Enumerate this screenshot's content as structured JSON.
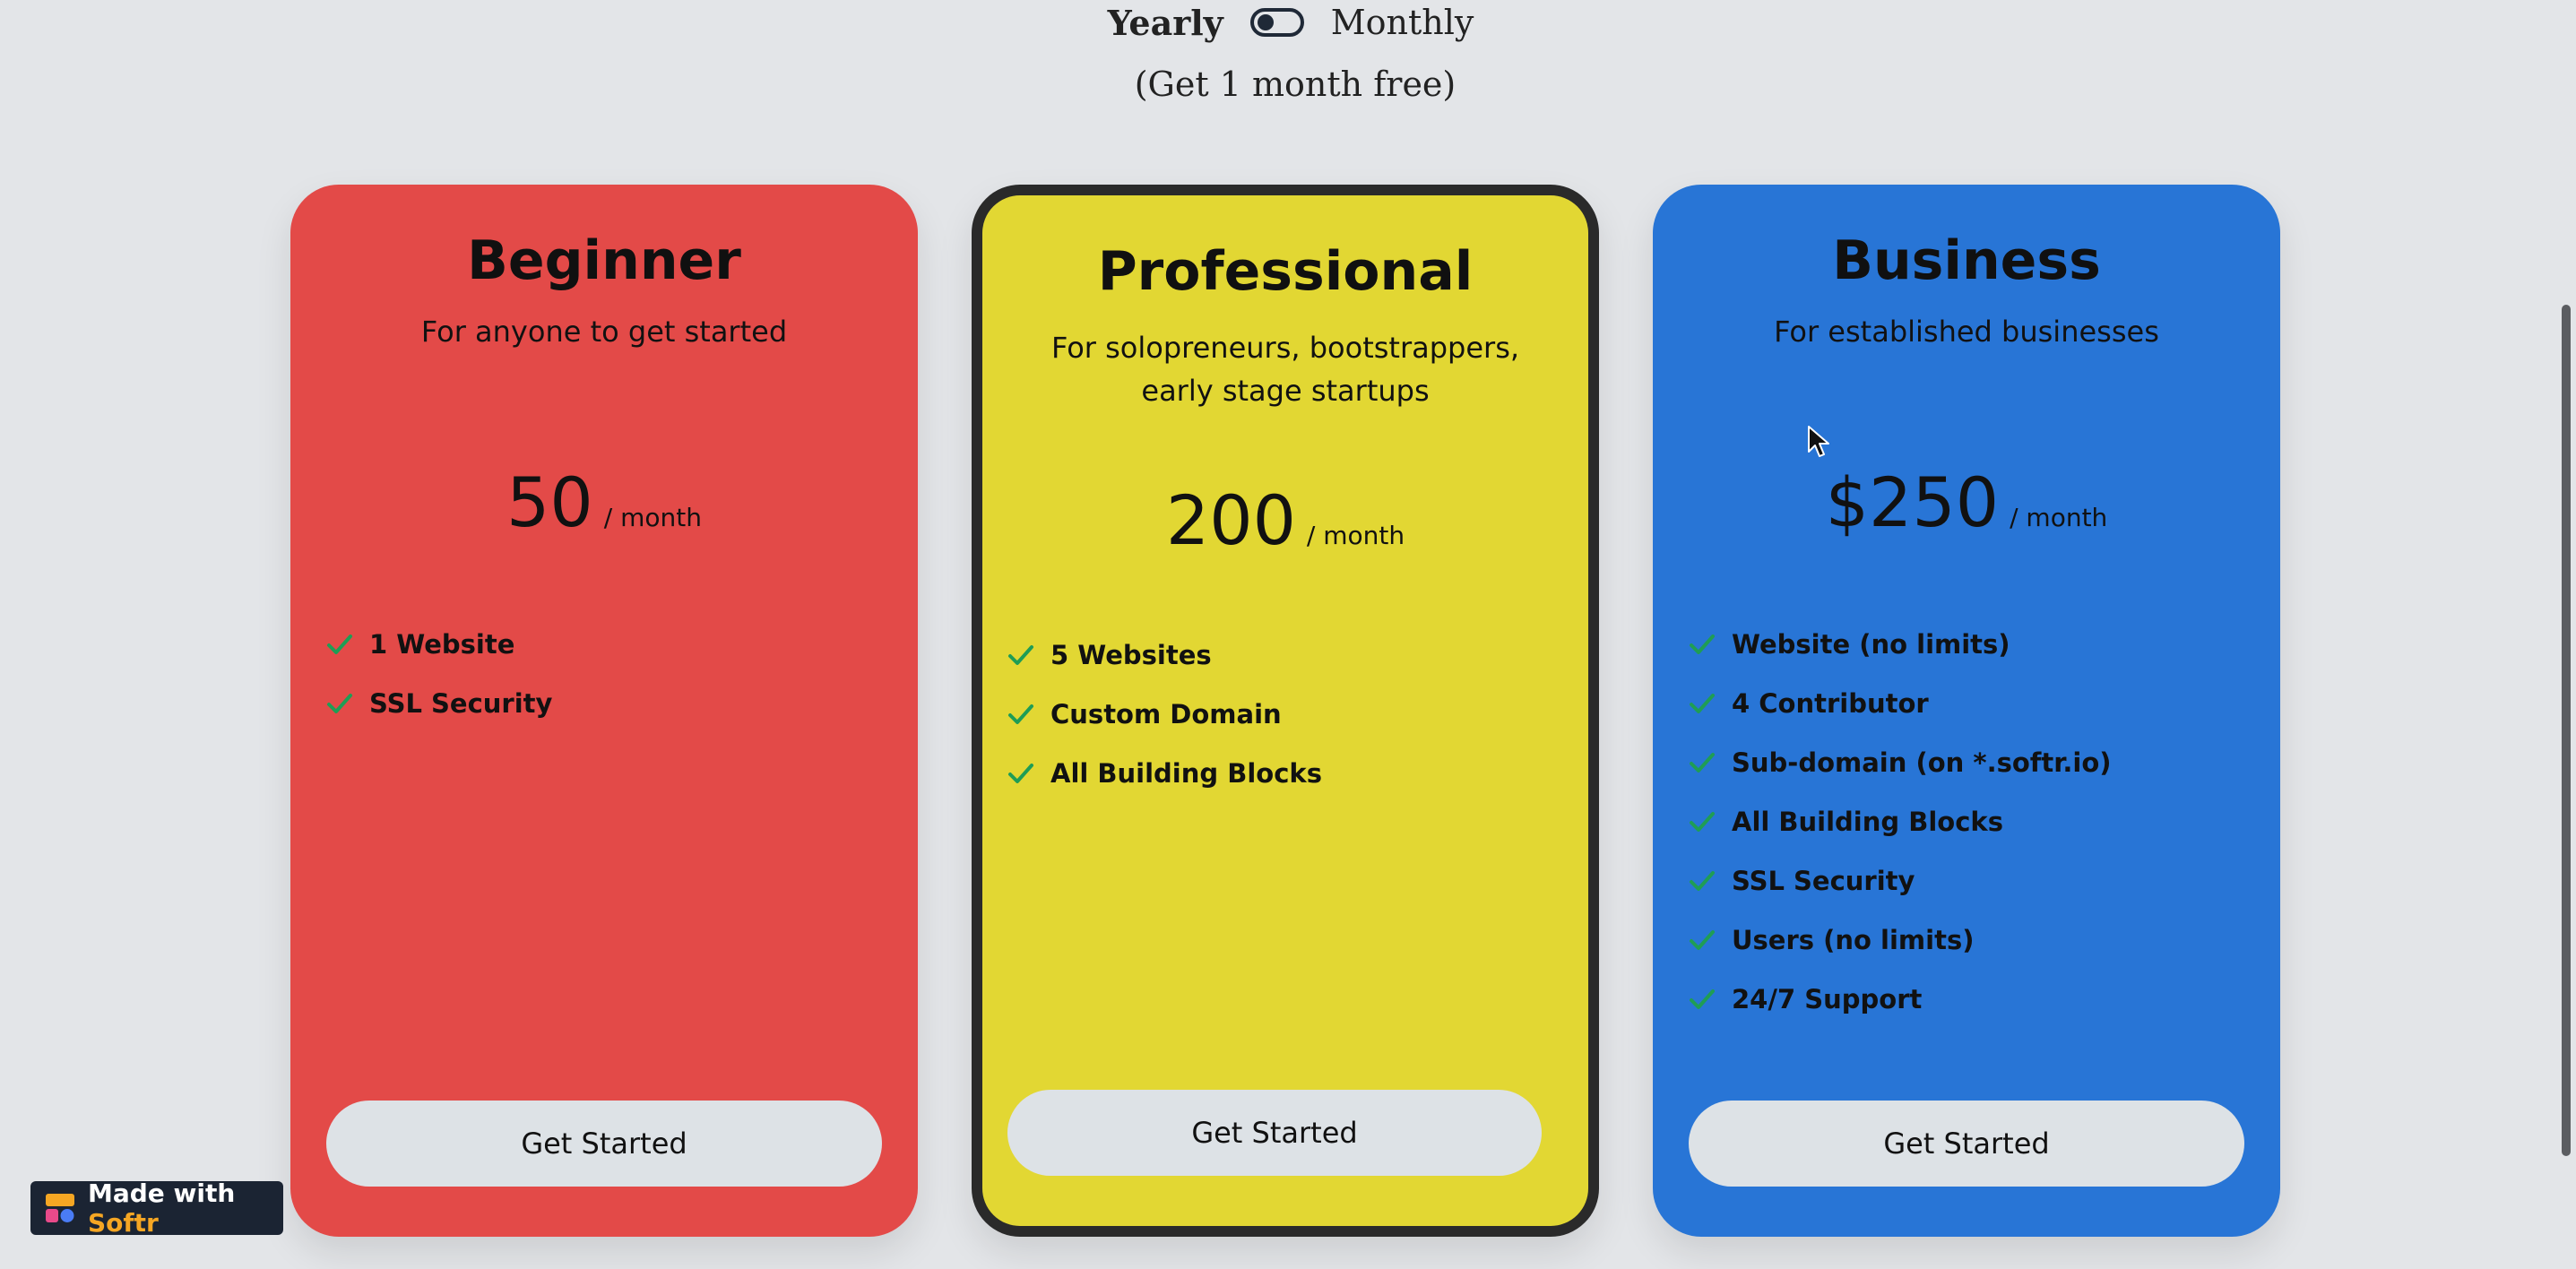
{
  "billing": {
    "yearly_label": "Yearly",
    "monthly_label": "Monthly",
    "free_note": "(Get 1 month free)"
  },
  "plans": [
    {
      "name": "Beginner",
      "description": "For anyone to get started",
      "price": "50",
      "period": "/ month",
      "features": [
        "1 Website",
        "SSL Security"
      ],
      "cta": "Get Started",
      "color": "#e34a48"
    },
    {
      "name": "Professional",
      "description": "For solopreneurs, bootstrappers, early stage startups",
      "price": "200",
      "period": "/ month",
      "features": [
        "5 Websites",
        "Custom Domain",
        "All Building Blocks"
      ],
      "cta": "Get Started",
      "color": "#e2d733"
    },
    {
      "name": "Business",
      "description": "For established businesses",
      "price": "$250",
      "period": "/ month",
      "features": [
        "Website (no limits)",
        "4 Contributor",
        "Sub-domain (on *.softr.io)",
        "All Building Blocks",
        "SSL Security",
        "Users (no limits)",
        "24/7 Support"
      ],
      "cta": "Get Started",
      "color": "#2875d6"
    }
  ],
  "badge": {
    "prefix": "Made with",
    "brand": "Softr"
  },
  "colors": {
    "check": "#1f9d55",
    "background": "#e3e5e8",
    "button": "#dde2e6"
  },
  "icons": {
    "check": "check-icon",
    "cursor": "cursor-icon",
    "logo": "softr-logo-icon"
  }
}
